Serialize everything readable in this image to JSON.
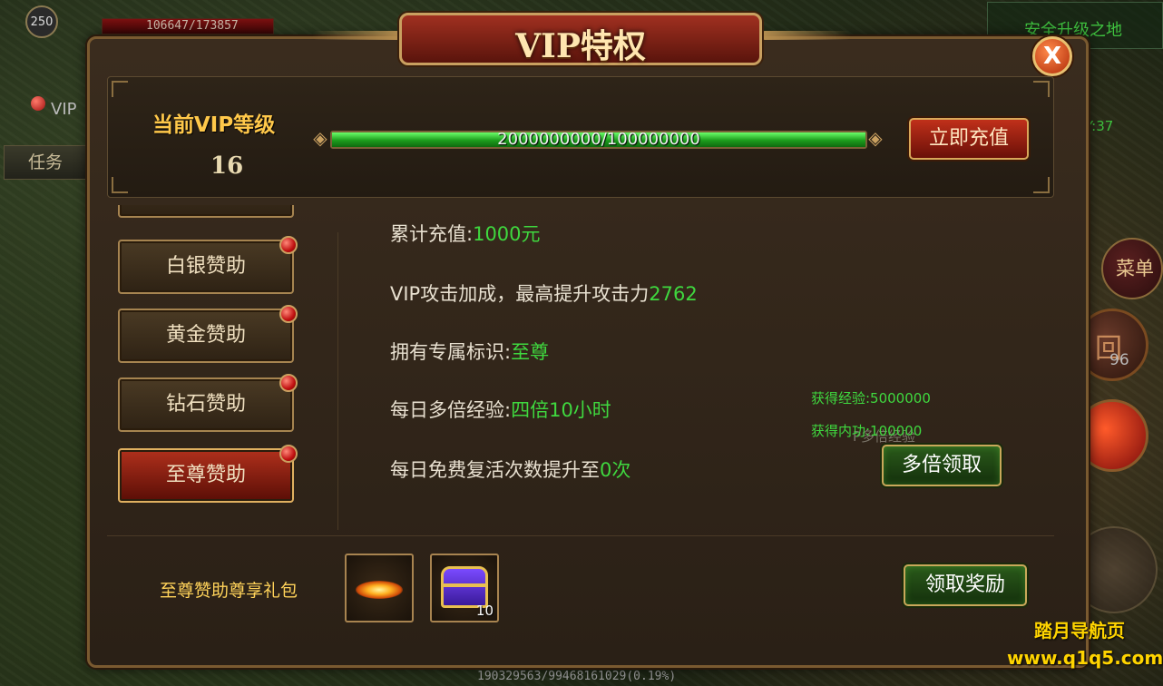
{
  "hud": {
    "player_level": "250",
    "hp_text": "106647/173857",
    "vip_text": "VIP",
    "task_label": "任务",
    "zone_name": "安全升级之地",
    "coord_text": "Y:37",
    "menu_label": "菜单",
    "skill_count": "96",
    "skill_glyph": "回",
    "exp_text": "190329563/99468161029(0.19%)"
  },
  "dialog": {
    "title": "VIP特权",
    "close_label": "X",
    "vip_level_label": "当前VIP等级",
    "vip_level": "16",
    "progress_text": "2000000000/100000000",
    "progress_fraction": 1.0,
    "recharge_button": "立即充值"
  },
  "tabs": [
    {
      "label": "白银赞助",
      "active": false
    },
    {
      "label": "黄金赞助",
      "active": false
    },
    {
      "label": "钻石赞助",
      "active": false
    },
    {
      "label": "至尊赞助",
      "active": true
    }
  ],
  "info": {
    "total_recharge_label": "累计充值:",
    "total_recharge_value": "1000元",
    "attack_label": "VIP攻击加成，最高提升攻击力",
    "attack_value": "2762",
    "badge_label": "拥有专属标识:",
    "badge_value": "至尊",
    "exp_label": "每日多倍经验:",
    "exp_value": "四倍10小时",
    "revive_label": "每日免费复活次数提升至",
    "revive_value": "0次"
  },
  "reward": {
    "gain_exp": "获得经验:5000000",
    "gain_inner": "获得内功:100000",
    "ghost_text": "P多倍经验",
    "multi_button": "多倍领取"
  },
  "gift": {
    "label": "至尊赞助尊享礼包",
    "items": [
      {
        "icon": "flame-item-icon",
        "count": ""
      },
      {
        "icon": "treasure-chest-icon",
        "count": "10"
      }
    ],
    "claim_button": "领取奖励"
  },
  "watermark": {
    "line1": "踏月导航页",
    "line2": "www.q1q5.com"
  }
}
